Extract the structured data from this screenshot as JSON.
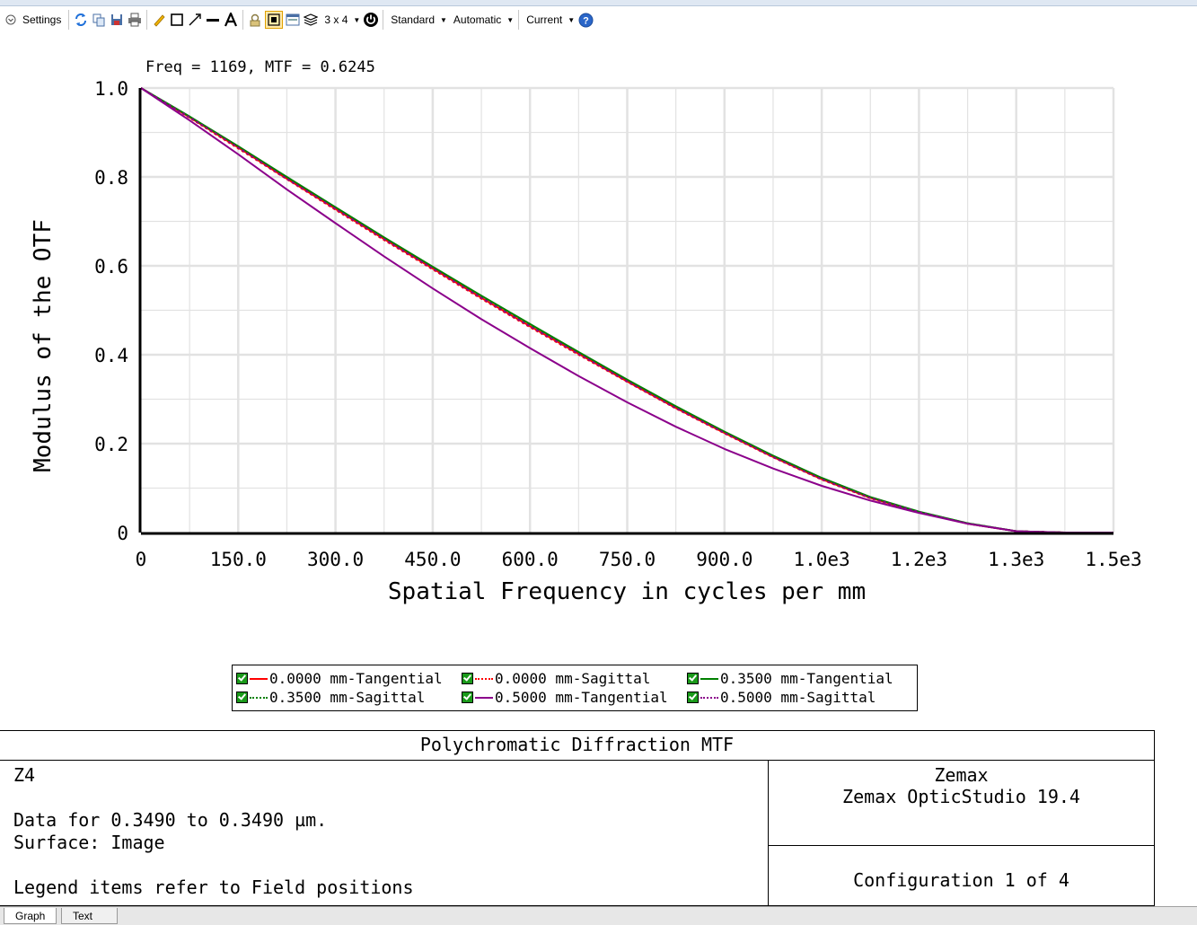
{
  "toolbar": {
    "settings_label": "Settings",
    "layout_label": "3 x 4",
    "standard_label": "Standard",
    "automatic_label": "Automatic",
    "current_label": "Current"
  },
  "chart_data": {
    "type": "line",
    "annotation": "Freq = 1169, MTF = 0.6245",
    "xlabel": "Spatial Frequency in cycles per mm",
    "ylabel": "Modulus of the OTF",
    "xlim": [
      0,
      1500
    ],
    "ylim": [
      0,
      1.0
    ],
    "x_ticks": [
      0,
      150,
      300,
      450,
      600,
      750,
      900,
      1050,
      1200,
      1350,
      1500
    ],
    "x_tick_labels": [
      "0",
      "150.0",
      "300.0",
      "450.0",
      "600.0",
      "750.0",
      "900.0",
      "1.0e3",
      "1.2e3",
      "1.3e3",
      "1.5e3"
    ],
    "y_ticks": [
      0,
      0.2,
      0.4,
      0.6,
      0.8,
      1.0
    ],
    "y_tick_labels": [
      "0",
      "0.2",
      "0.4",
      "0.6",
      "0.8",
      "1.0"
    ],
    "grid": true,
    "x": [
      0,
      75,
      150,
      225,
      300,
      375,
      450,
      525,
      600,
      675,
      750,
      825,
      900,
      975,
      1050,
      1125,
      1200,
      1275,
      1350,
      1425,
      1500
    ],
    "series": [
      {
        "name": "0.0000 mm-Tangential",
        "color": "#ff0000",
        "dash": "solid",
        "values": [
          1.0,
          0.934,
          0.866,
          0.796,
          0.728,
          0.66,
          0.594,
          0.528,
          0.464,
          0.402,
          0.34,
          0.28,
          0.224,
          0.17,
          0.12,
          0.078,
          0.046,
          0.02,
          0.003,
          0.0,
          0.0
        ]
      },
      {
        "name": "0.0000 mm-Sagittal",
        "color": "#ff0000",
        "dash": "dotted",
        "values": [
          1.0,
          0.933,
          0.864,
          0.795,
          0.726,
          0.658,
          0.592,
          0.526,
          0.462,
          0.4,
          0.339,
          0.279,
          0.223,
          0.169,
          0.119,
          0.077,
          0.046,
          0.02,
          0.003,
          0.0,
          0.0
        ]
      },
      {
        "name": "0.3500 mm-Tangential",
        "color": "#008000",
        "dash": "solid",
        "values": [
          1.0,
          0.936,
          0.869,
          0.8,
          0.732,
          0.664,
          0.598,
          0.533,
          0.469,
          0.406,
          0.344,
          0.284,
          0.227,
          0.173,
          0.123,
          0.08,
          0.047,
          0.021,
          0.003,
          0.0,
          0.0
        ]
      },
      {
        "name": "0.3500 mm-Sagittal",
        "color": "#008000",
        "dash": "dotted",
        "values": [
          1.0,
          0.935,
          0.867,
          0.798,
          0.73,
          0.662,
          0.596,
          0.531,
          0.467,
          0.404,
          0.342,
          0.282,
          0.225,
          0.171,
          0.121,
          0.079,
          0.046,
          0.021,
          0.003,
          0.0,
          0.0
        ]
      },
      {
        "name": "0.5000 mm-Tangential",
        "color": "#8b008b",
        "dash": "solid",
        "values": [
          1.0,
          0.927,
          0.851,
          0.772,
          0.696,
          0.621,
          0.549,
          0.48,
          0.415,
          0.352,
          0.293,
          0.238,
          0.188,
          0.144,
          0.105,
          0.072,
          0.044,
          0.02,
          0.003,
          0.0,
          0.0
        ]
      },
      {
        "name": "0.5000 mm-Sagittal",
        "color": "#8b008b",
        "dash": "dotted",
        "values": [
          1.0,
          0.934,
          0.866,
          0.796,
          0.728,
          0.66,
          0.594,
          0.528,
          0.464,
          0.402,
          0.34,
          0.28,
          0.224,
          0.17,
          0.12,
          0.078,
          0.046,
          0.02,
          0.003,
          0.0,
          0.0
        ]
      }
    ]
  },
  "legend": {
    "items": [
      {
        "label": "0.0000 mm-Tangential",
        "color": "#ff0000",
        "dash": "solid"
      },
      {
        "label": "0.0000 mm-Sagittal",
        "color": "#ff0000",
        "dash": "dotted"
      },
      {
        "label": "0.3500 mm-Tangential",
        "color": "#008000",
        "dash": "solid"
      },
      {
        "label": "0.3500 mm-Sagittal",
        "color": "#008000",
        "dash": "dotted"
      },
      {
        "label": "0.5000 mm-Tangential",
        "color": "#8b008b",
        "dash": "solid"
      },
      {
        "label": "0.5000 mm-Sagittal",
        "color": "#8b008b",
        "dash": "dotted"
      }
    ]
  },
  "info": {
    "title": "Polychromatic Diffraction MTF",
    "file_name": "Z4",
    "data_line": "Data for 0.3490 to 0.3490 µm.",
    "surface_line": "Surface: Image",
    "legend_note": "Legend items refer to Field positions",
    "company": "Zemax",
    "product": "Zemax OpticStudio 19.4",
    "configuration": "Configuration 1 of 4"
  },
  "tabs": {
    "graph": "Graph",
    "text": "Text"
  }
}
